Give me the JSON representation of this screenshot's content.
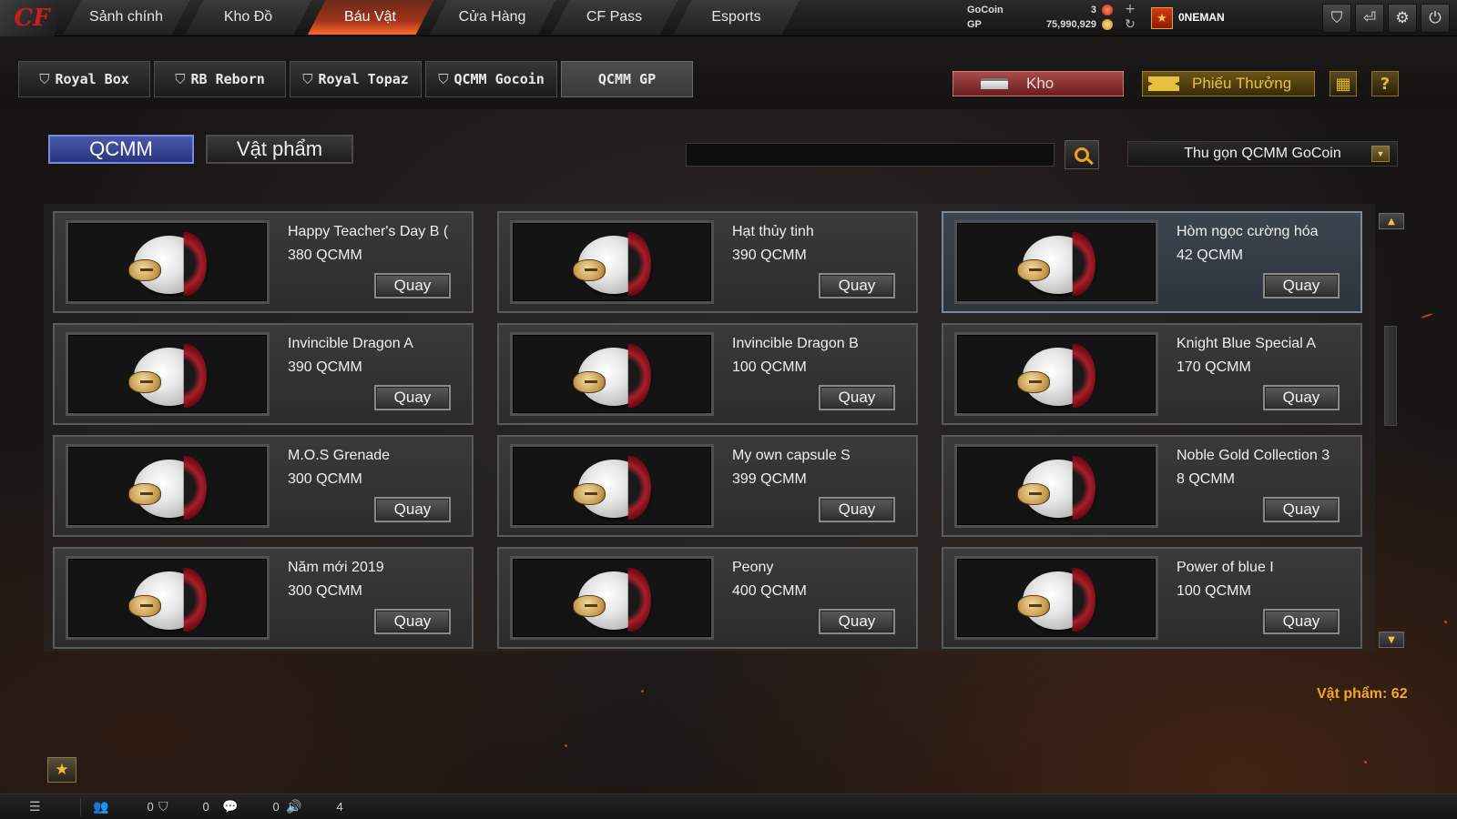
{
  "nav": {
    "logo": "CF",
    "tabs": [
      {
        "label": "Sảnh chính",
        "active": false
      },
      {
        "label": "Kho Đồ",
        "active": false
      },
      {
        "label": "Báu Vật",
        "active": true
      },
      {
        "label": "Cửa Hàng",
        "active": false
      },
      {
        "label": "CF Pass",
        "active": false
      },
      {
        "label": "Esports",
        "active": false
      }
    ]
  },
  "currency": {
    "gocoin_label": "GoCoin",
    "gocoin_value": "3",
    "gp_label": "GP",
    "gp_value": "75,990,929"
  },
  "user": {
    "name": "0NEMAN"
  },
  "subtabs": [
    {
      "label": "Royal Box",
      "icon": "rb-icon",
      "active": false
    },
    {
      "label": "RB Reborn",
      "icon": "rb-icon",
      "active": false
    },
    {
      "label": "Royal Topaz",
      "icon": "rb-icon",
      "active": false
    },
    {
      "label": "QCMM Gocoin",
      "icon": "rb-icon",
      "active": false
    },
    {
      "label": "QCMM GP",
      "icon": "",
      "active": true
    }
  ],
  "actions": {
    "kho_label": "Kho",
    "phieu_label": "Phiếu Thưởng"
  },
  "filter": {
    "seg_qcmm": "QCMM",
    "seg_vatpham": "Vật phẩm",
    "search_value": "",
    "search_placeholder": "",
    "dropdown_value": "Thu gọn QCMM GoCoin"
  },
  "items": [
    {
      "name": "Happy Teacher's Day B (",
      "price": "380 QCMM",
      "button": "Quay",
      "highlight": false
    },
    {
      "name": "Hạt thủy tinh",
      "price": "390 QCMM",
      "button": "Quay",
      "highlight": false
    },
    {
      "name": "Hòm ngọc cường hóa",
      "price": "42 QCMM",
      "button": "Quay",
      "highlight": true
    },
    {
      "name": "Invincible Dragon A",
      "price": "390 QCMM",
      "button": "Quay",
      "highlight": false
    },
    {
      "name": "Invincible Dragon B",
      "price": "100 QCMM",
      "button": "Quay",
      "highlight": false
    },
    {
      "name": "Knight Blue Special A",
      "price": "170 QCMM",
      "button": "Quay",
      "highlight": false
    },
    {
      "name": "M.O.S Grenade",
      "price": "300 QCMM",
      "button": "Quay",
      "highlight": false
    },
    {
      "name": "My own capsule S",
      "price": "399 QCMM",
      "button": "Quay",
      "highlight": false
    },
    {
      "name": "Noble Gold Collection 3",
      "price": "8 QCMM",
      "button": "Quay",
      "highlight": false
    },
    {
      "name": "Năm mới 2019",
      "price": "300 QCMM",
      "button": "Quay",
      "highlight": false
    },
    {
      "name": "Peony",
      "price": "400 QCMM",
      "button": "Quay",
      "highlight": false
    },
    {
      "name": "Power of blue I",
      "price": "100 QCMM",
      "button": "Quay",
      "highlight": false
    }
  ],
  "item_count": "Vật phẩm: 62",
  "bottom": {
    "friends_count": "0",
    "clan_count": "0",
    "chat_count": "0",
    "volume_level": "4"
  },
  "colors": {
    "accent_orange": "#f0a820",
    "active_tab": "#a0341a",
    "segment_blue": "#4a5aa8"
  }
}
